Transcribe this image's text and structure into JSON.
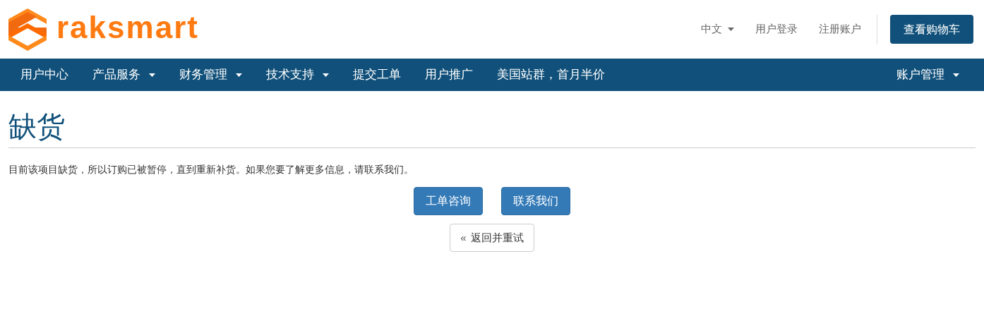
{
  "logo": {
    "text": "raksmart"
  },
  "top_links": [
    {
      "label": "中文",
      "dropdown": true
    },
    {
      "label": "用户登录",
      "dropdown": false
    },
    {
      "label": "注册账户",
      "dropdown": false
    }
  ],
  "cart_button": "查看购物车",
  "nav": {
    "items": [
      {
        "label": "用户中心",
        "dropdown": false
      },
      {
        "label": "产品服务",
        "dropdown": true
      },
      {
        "label": "财务管理",
        "dropdown": true
      },
      {
        "label": "技术支持",
        "dropdown": true
      },
      {
        "label": "提交工单",
        "dropdown": false
      },
      {
        "label": "用户推广",
        "dropdown": false
      },
      {
        "label": "美国站群，首月半价",
        "dropdown": false
      }
    ],
    "right_items": [
      {
        "label": "账户管理",
        "dropdown": true
      }
    ]
  },
  "page": {
    "title": "缺货",
    "message": "目前该项目缺货，所以订购已被暂停，直到重新补货。如果您要了解更多信息，请联系我们。",
    "buttons": [
      "工单咨询",
      "联系我们"
    ],
    "back_button": {
      "icon": "«",
      "label": "返回并重试"
    }
  }
}
